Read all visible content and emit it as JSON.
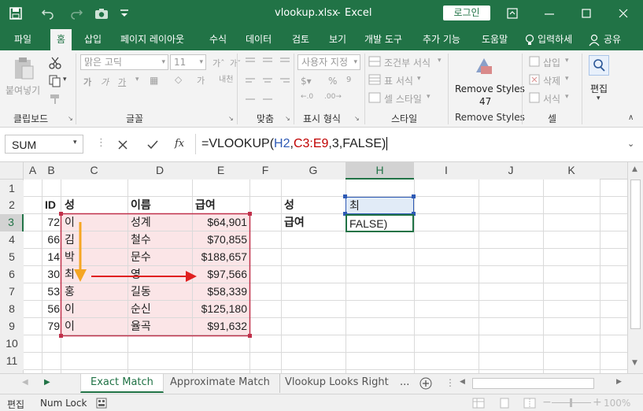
{
  "titlebar": {
    "filename": "vlookup.xlsx",
    "separator": "-",
    "app": "Excel",
    "login": "로그인"
  },
  "tabs": [
    "파일",
    "홈",
    "삽입",
    "페이지 레이아웃",
    "수식",
    "데이터",
    "검토",
    "보기",
    "개발 도구",
    "추가 기능",
    "도움말",
    "입력하세",
    "공유"
  ],
  "active_tab": "홈",
  "ribbon": {
    "clipboard": {
      "paste": "붙여넣기",
      "label": "클립보드"
    },
    "font": {
      "name": "맑은 고딕",
      "size": "11",
      "label": "글꼴",
      "bold": "가",
      "italic": "가",
      "underline": "가"
    },
    "alignment": {
      "label": "맞춤",
      "wrap": "내어"
    },
    "number": {
      "format": "사용자 지정",
      "label": "표시 형식"
    },
    "styles": {
      "conditional": "조건부 서식",
      "table": "표 서식",
      "cell": "셀 스타일",
      "label": "스타일"
    },
    "remove_styles": {
      "line1": "Remove Styles",
      "line2": "47",
      "label": "Remove Styles"
    },
    "cells": {
      "insert": "삽입",
      "delete": "삭제",
      "format": "서식",
      "label": "셀"
    },
    "editing": {
      "label": "편집"
    }
  },
  "formula_bar": {
    "name_box": "SUM",
    "fx": "fx",
    "formula_prefix": "=VLOOKUP(",
    "arg1": "H2",
    "comma1": ",",
    "arg2": "C3:E9",
    "rest": ",3,FALSE)"
  },
  "columns": [
    "A",
    "B",
    "C",
    "D",
    "E",
    "F",
    "G",
    "H",
    "I",
    "J",
    "K"
  ],
  "rows": [
    "1",
    "2",
    "3",
    "4",
    "5",
    "6",
    "7",
    "8",
    "9",
    "10",
    "11"
  ],
  "table": {
    "headers": {
      "id": "ID",
      "surname": "성",
      "name": "이름",
      "salary": "급여"
    },
    "rows": [
      {
        "id": "72",
        "surname": "이",
        "name": "성계",
        "salary": "$64,901"
      },
      {
        "id": "66",
        "surname": "김",
        "name": "철수",
        "salary": "$70,855"
      },
      {
        "id": "14",
        "surname": "박",
        "name": "문수",
        "salary": "$188,657"
      },
      {
        "id": "30",
        "surname": "최",
        "name": "영",
        "salary": "$97,566"
      },
      {
        "id": "53",
        "surname": "홍",
        "name": "길동",
        "salary": "$58,339"
      },
      {
        "id": "56",
        "surname": "이",
        "name": "순신",
        "salary": "$125,180"
      },
      {
        "id": "79",
        "surname": "이",
        "name": "율곡",
        "salary": "$91,632"
      }
    ]
  },
  "lookup": {
    "label1": "성",
    "value1": "최",
    "label2": "급여",
    "value2": "FALSE)"
  },
  "colors": {
    "accent": "#217346",
    "pink": "#fbe5e7",
    "red": "#c00000",
    "arrow_orange": "#f5a623",
    "arrow_red": "#e02020"
  },
  "sheets": [
    "Exact Match",
    "Approximate Match",
    "Vlookup Looks Right"
  ],
  "active_sheet": "Exact Match",
  "sheet_more": "...",
  "status": {
    "mode": "편집",
    "numlock": "Num Lock",
    "zoom": "100%"
  }
}
